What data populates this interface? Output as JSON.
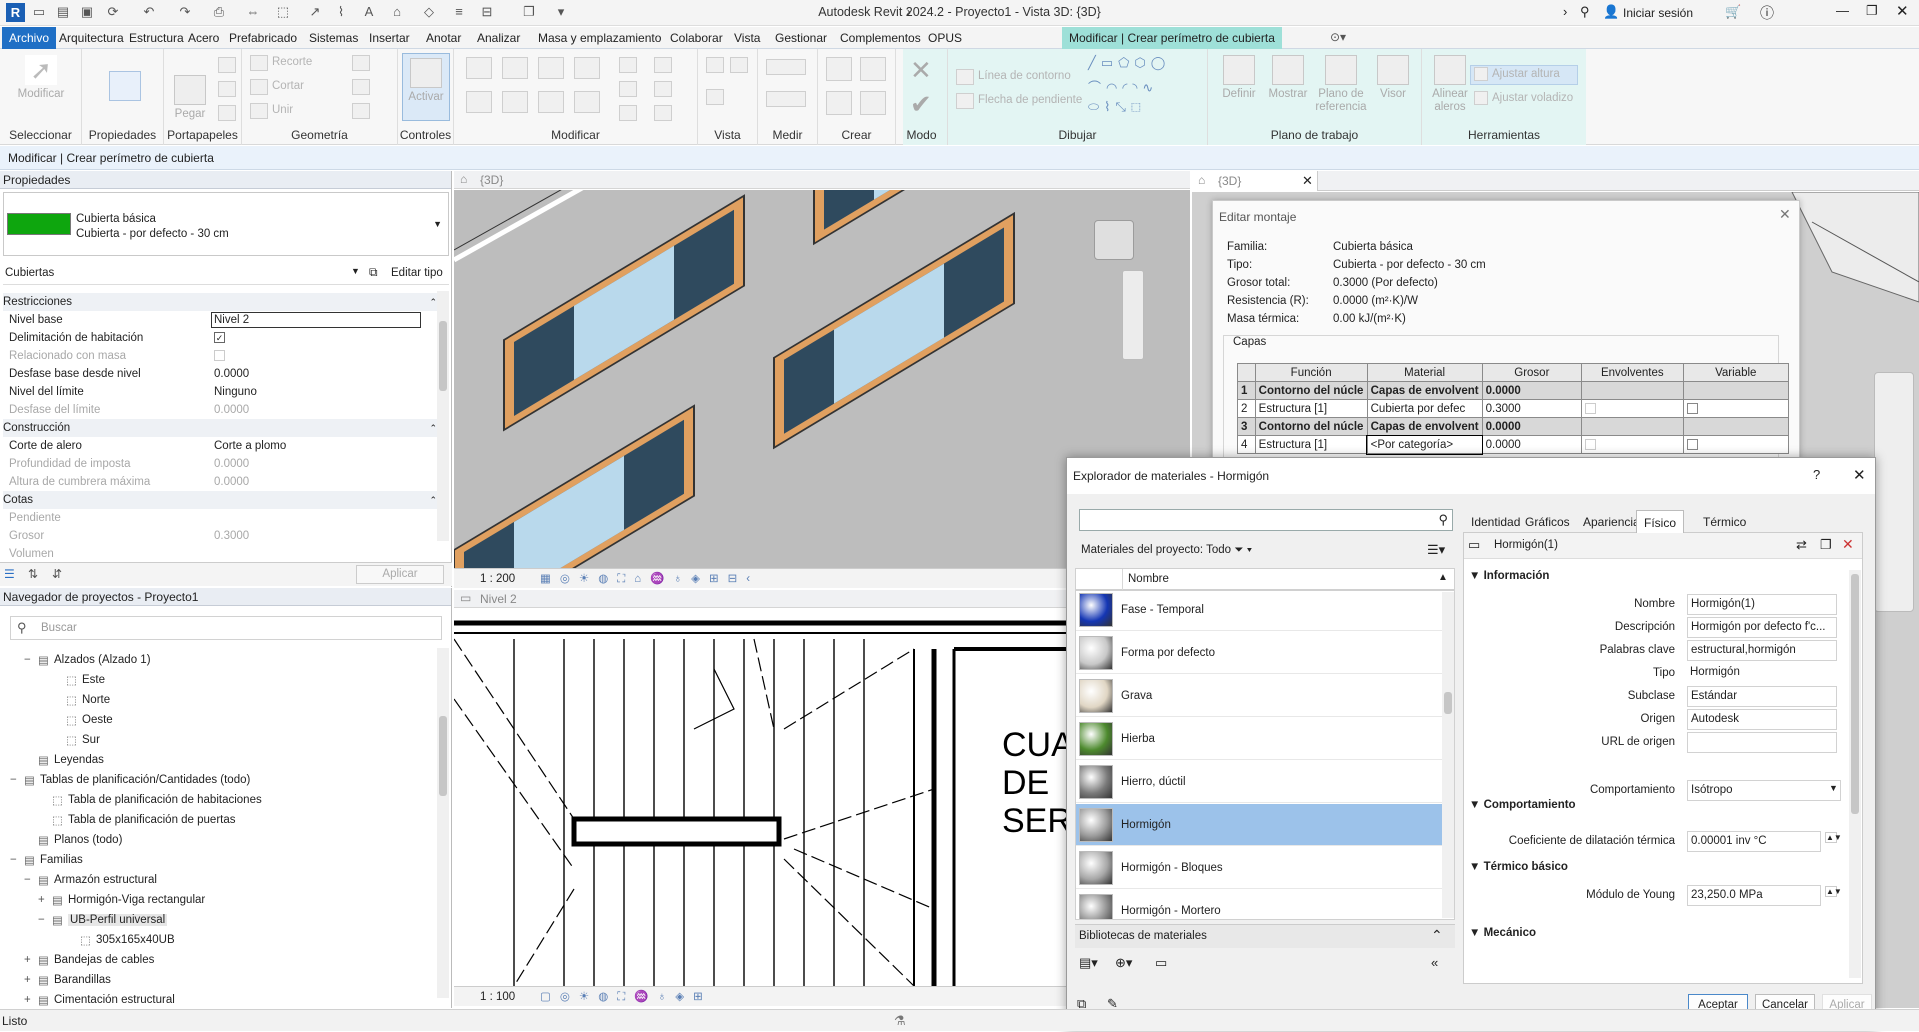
{
  "app": {
    "title": "Autodesk Revit 2024.2 - Proyecto1 - Vista 3D: {3D}",
    "login": "Iniciar sesión",
    "logo": "R"
  },
  "menu": {
    "tabs": [
      "Archivo",
      "Arquitectura",
      "Estructura",
      "Acero",
      "Prefabricado",
      "Sistemas",
      "Insertar",
      "Anotar",
      "Analizar",
      "Masa y emplazamiento",
      "Colaborar",
      "Vista",
      "Gestionar",
      "Complementos",
      "OPUS",
      "Modificar | Crear perímetro de cubierta"
    ]
  },
  "ribbon": {
    "panels": [
      "Seleccionar",
      "Propiedades",
      "Portapapeles",
      "Geometría",
      "Controles",
      "Modificar",
      "Vista",
      "Medir",
      "Crear",
      "Modo",
      "Dibujar",
      "Plano de trabajo",
      "Herramientas"
    ],
    "modificar": "Modificar",
    "pegar": "Pegar",
    "recorte": "Recorte",
    "cortar": "Cortar",
    "unir": "Unir",
    "activar": "Activar",
    "linea_contorno": "Línea de contorno",
    "flecha_pendiente": "Flecha de pendiente",
    "definir": "Definir",
    "mostrar": "Mostrar",
    "plano_ref": "Plano de referencia",
    "visor": "Visor",
    "alinear_aleros": "Alinear aleros",
    "ajustar_altura": "Ajustar altura",
    "ajustar_voladizo": "Ajustar voladizo"
  },
  "contextbar": "Modificar | Crear perímetro de cubierta",
  "properties": {
    "title": "Propiedades",
    "type_family": "Cubierta básica",
    "type_name": "Cubierta - por defecto - 30 cm",
    "category": "Cubiertas",
    "edit_type": "Editar tipo",
    "apply": "Aplicar",
    "rows": [
      {
        "k": "Restricciones",
        "cat": true
      },
      {
        "k": "Nivel base",
        "v": "Nivel 2"
      },
      {
        "k": "Delimitación de habitación",
        "v": "",
        "check": true
      },
      {
        "k": "Relacionado con masa",
        "v": "",
        "dis": true,
        "check": false
      },
      {
        "k": "Desfase base desde nivel",
        "v": "0.0000"
      },
      {
        "k": "Nivel del límite",
        "v": "Ninguno"
      },
      {
        "k": "Desfase del límite",
        "v": "0.0000",
        "dis": true
      },
      {
        "k": "Construcción",
        "cat": true
      },
      {
        "k": "Corte de alero",
        "v": "Corte a plomo"
      },
      {
        "k": "Profundidad de imposta",
        "v": "0.0000",
        "dis": true
      },
      {
        "k": "Altura de cumbrera máxima",
        "v": "0.0000",
        "dis": true
      },
      {
        "k": "Cotas",
        "cat": true
      },
      {
        "k": "Pendiente",
        "v": "",
        "dis": true
      },
      {
        "k": "Grosor",
        "v": "0.3000",
        "dis": true
      },
      {
        "k": "Volumen",
        "v": "",
        "dis": true
      }
    ]
  },
  "browser": {
    "title": "Navegador de proyectos - Proyecto1",
    "search_placeholder": "Buscar",
    "items": [
      {
        "t": "Alzados (Alzado 1)",
        "lv": 1,
        "sign": "−"
      },
      {
        "t": "Este",
        "lv": 3
      },
      {
        "t": "Norte",
        "lv": 3
      },
      {
        "t": "Oeste",
        "lv": 3
      },
      {
        "t": "Sur",
        "lv": 3
      },
      {
        "t": "Leyendas",
        "lv": 1
      },
      {
        "t": "Tablas de planificación/Cantidades (todo)",
        "lv": 0,
        "sign": "−"
      },
      {
        "t": "Tabla de planificación de habitaciones",
        "lv": 2
      },
      {
        "t": "Tabla de planificación de puertas",
        "lv": 2
      },
      {
        "t": "Planos (todo)",
        "lv": 1
      },
      {
        "t": "Familias",
        "lv": 0,
        "sign": "−"
      },
      {
        "t": "Armazón estructural",
        "lv": 1,
        "sign": "−"
      },
      {
        "t": "Hormigón-Viga rectangular",
        "lv": 2,
        "sign": "+"
      },
      {
        "t": "UB-Perfil universal",
        "lv": 2,
        "sign": "−"
      },
      {
        "t": "305x165x40UB",
        "lv": 4
      },
      {
        "t": "Bandejas de cables",
        "lv": 1,
        "sign": "+"
      },
      {
        "t": "Barandillas",
        "lv": 1,
        "sign": "+"
      },
      {
        "t": "Cimentación estructural",
        "lv": 1,
        "sign": "+"
      }
    ]
  },
  "views": {
    "v3d_tab": "{3D}",
    "v3d_tab2": "{3D}",
    "v3d_scale": "1 : 200",
    "plan_tab": "Nivel 2",
    "plan_scale": "1 : 100",
    "plan_text": [
      "CUA",
      "DE",
      "SER"
    ]
  },
  "status": "Listo",
  "edit_assembly": {
    "title": "Editar montaje",
    "info": [
      [
        "Familia:",
        "Cubierta básica"
      ],
      [
        "Tipo:",
        "Cubierta - por defecto - 30 cm"
      ],
      [
        "Grosor total:",
        "0.3000 (Por defecto)"
      ],
      [
        "Resistencia (R):",
        "0.0000 (m²·K)/W"
      ],
      [
        "Masa térmica:",
        "0.00 kJ/(m²·K)"
      ]
    ],
    "layers_label": "Capas",
    "headers": [
      "",
      "Función",
      "Material",
      "Grosor",
      "Envolventes",
      "Variable"
    ],
    "rows": [
      {
        "n": "1",
        "f": "Contorno del núcle",
        "m": "Capas de envolvent",
        "g": "0.0000",
        "core": true
      },
      {
        "n": "2",
        "f": "Estructura [1]",
        "m": "Cubierta por defec",
        "g": "0.3000"
      },
      {
        "n": "3",
        "f": "Contorno del núcle",
        "m": "Capas de envolvent",
        "g": "0.0000",
        "core": true
      },
      {
        "n": "4",
        "f": "Estructura [1]",
        "m": "<Por categoría>",
        "g": "0.0000"
      }
    ]
  },
  "material_browser": {
    "title": "Explorador de materiales - Hormigón",
    "filter_label": "Materiales del proyecto: Todo",
    "col_name": "Nombre",
    "materials": [
      {
        "name": "Fase - Temporal",
        "color": "#1436b4"
      },
      {
        "name": "Forma por defecto",
        "color": "#c8c8c8"
      },
      {
        "name": "Grava",
        "color": "#e0d6c4"
      },
      {
        "name": "Hierba",
        "color": "#4d8a2e"
      },
      {
        "name": "Hierro, dúctil",
        "color": "#7a7a7a"
      },
      {
        "name": "Hormigón",
        "color": "#9a9a9a",
        "selected": true
      },
      {
        "name": "Hormigón - Bloques",
        "color": "#a7a7a7"
      },
      {
        "name": "Hormigón - Mortero",
        "color": "#8e8e8e"
      }
    ],
    "libraries": "Bibliotecas de materiales",
    "tabs": [
      "Identidad",
      "Gráficos",
      "Apariencia",
      "Físico",
      "Térmico"
    ],
    "asset_name": "Hormigón(1)",
    "sections": {
      "info": "Información",
      "behavior": "Comportamiento",
      "thermal": "Térmico básico",
      "mechanical": "Mecánico"
    },
    "fields": {
      "Nombre": "Hormigón(1)",
      "Descripción": "Hormigón por defecto f'c...",
      "Palabras clave": "estructural,hormigón",
      "Tipo": "Hormigón",
      "Subclase": "Estándar",
      "Origen": "Autodesk",
      "URL de origen": "",
      "Comportamiento": "Isótropo",
      "Coeficiente de dilatación térmica": "0.00001 inv °C",
      "Módulo de Young": "23,250.0 MPa"
    },
    "buttons": {
      "ok": "Aceptar",
      "cancel": "Cancelar",
      "apply": "Aplicar"
    }
  }
}
